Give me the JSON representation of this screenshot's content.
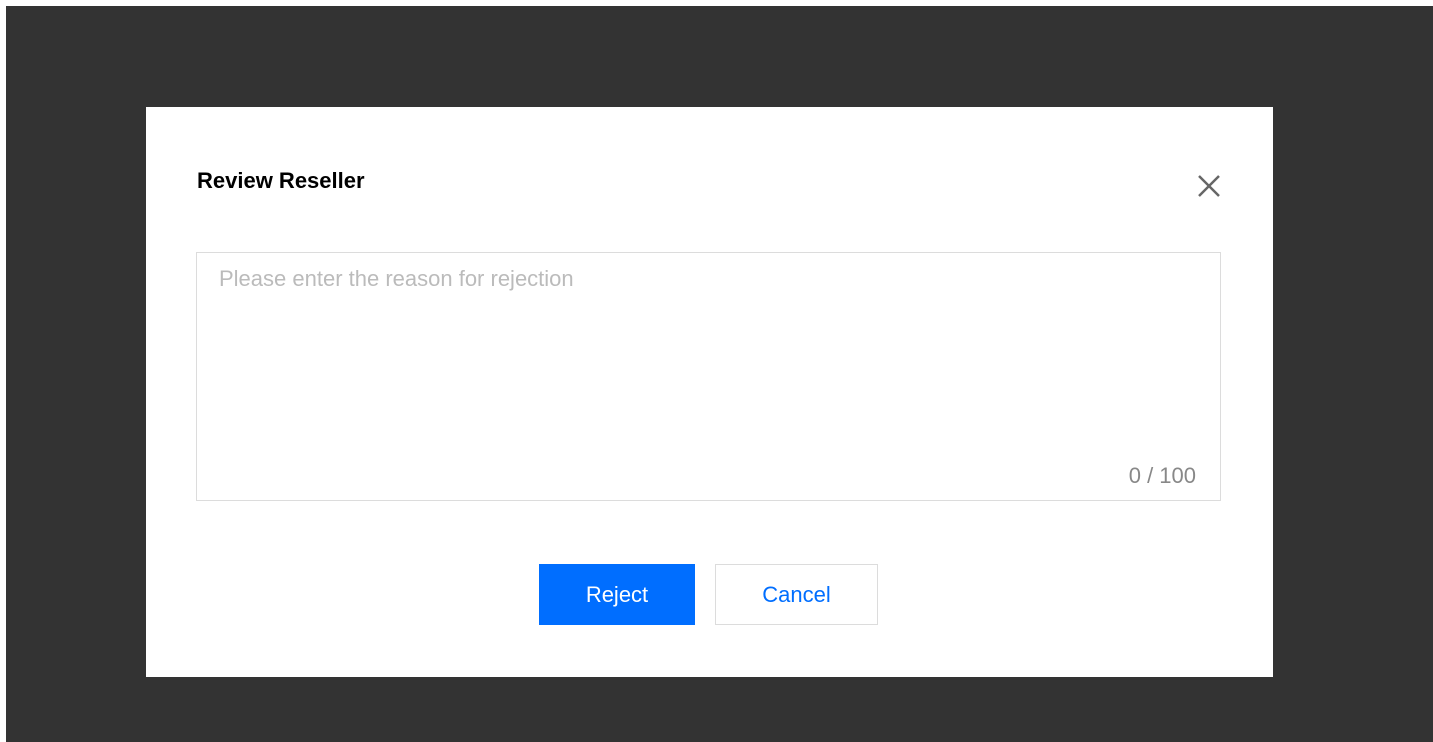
{
  "dialog": {
    "title": "Review Reseller",
    "reason": {
      "value": "",
      "placeholder": "Please enter the reason for rejection",
      "counter": "0 / 100"
    },
    "buttons": {
      "reject_label": "Reject",
      "cancel_label": "Cancel"
    },
    "close_icon": "close-icon"
  },
  "colors": {
    "overlay": "#333333",
    "primary": "#006eff",
    "border": "#dcdcdc",
    "placeholder": "#bbbbbb"
  }
}
